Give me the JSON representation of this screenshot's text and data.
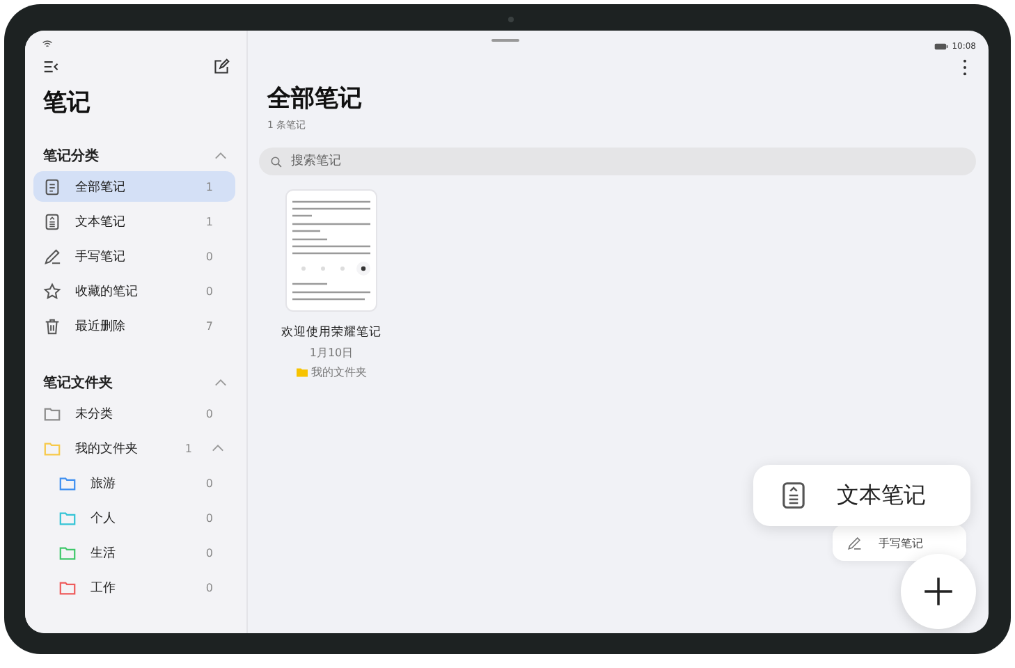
{
  "status_bar": {
    "time": "10:08"
  },
  "sidebar": {
    "title": "笔记",
    "categories": {
      "title": "笔记分类",
      "expanded": true,
      "items": [
        {
          "label": "全部笔记",
          "count": "1",
          "kind": "all",
          "selected": true
        },
        {
          "label": "文本笔记",
          "count": "1",
          "kind": "text",
          "selected": false
        },
        {
          "label": "手写笔记",
          "count": "0",
          "kind": "handwriting",
          "selected": false
        },
        {
          "label": "收藏的笔记",
          "count": "0",
          "kind": "star",
          "selected": false
        },
        {
          "label": "最近删除",
          "count": "7",
          "kind": "trash",
          "selected": false
        }
      ]
    },
    "folders": {
      "title": "笔记文件夹",
      "expanded": true,
      "items": [
        {
          "label": "未分类",
          "count": "0",
          "color": "#8c8c8c",
          "selected": false
        },
        {
          "label": "我的文件夹",
          "count": "1",
          "color": "#f7c948",
          "selected": false,
          "expanded": true,
          "children": [
            {
              "label": "旅游",
              "count": "0",
              "color": "#3d8ef0",
              "selected": false
            },
            {
              "label": "个人",
              "count": "0",
              "color": "#33c4d6",
              "selected": false
            },
            {
              "label": "生活",
              "count": "0",
              "color": "#3fc86a",
              "selected": false
            },
            {
              "label": "工作",
              "count": "0",
              "color": "#ee5b5b",
              "selected": false
            }
          ]
        }
      ]
    }
  },
  "main": {
    "title": "全部笔记",
    "subtitle": "1 条笔记",
    "search": {
      "placeholder": "搜索笔记"
    },
    "notes": [
      {
        "title": "欢迎使用荣耀笔记",
        "date": "1月10日",
        "folder": "我的文件夹"
      }
    ],
    "new_note_menu": [
      {
        "label": "文本笔记",
        "kind": "text",
        "selected": true
      },
      {
        "label": "手写笔记",
        "kind": "handwriting",
        "selected": false
      }
    ]
  }
}
